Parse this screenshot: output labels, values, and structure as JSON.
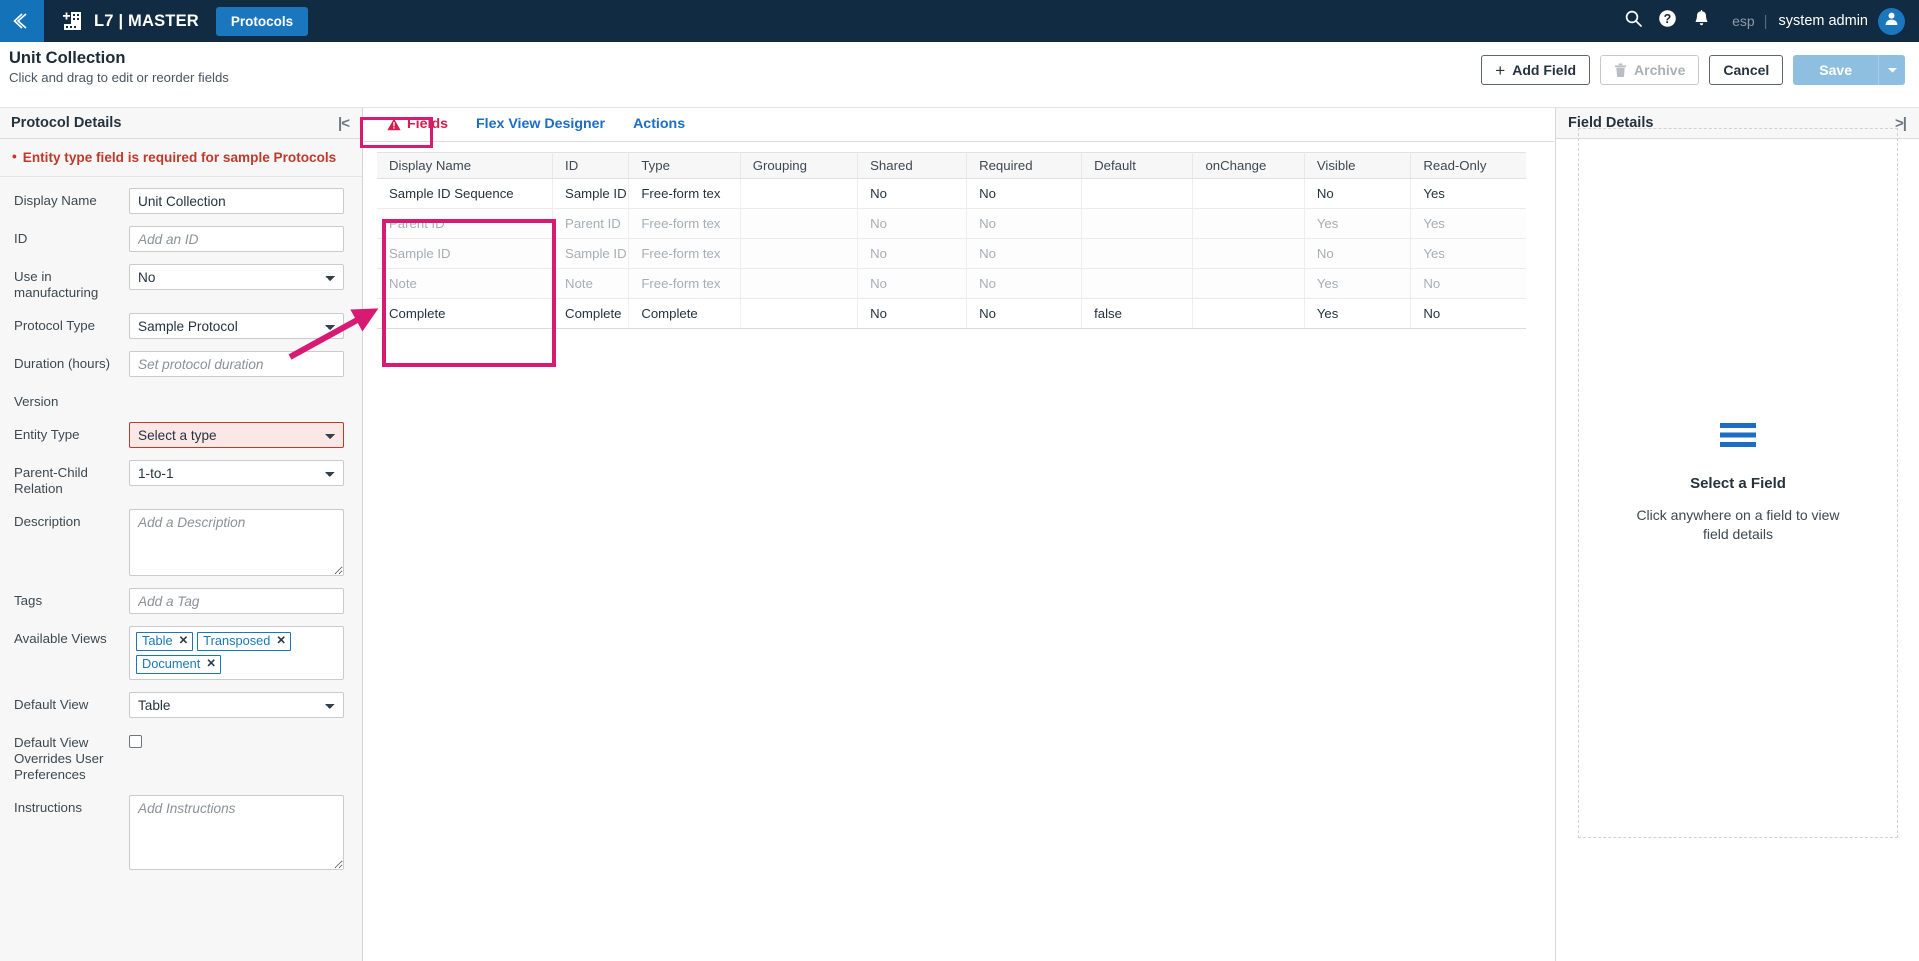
{
  "topnav": {
    "back_icon": "chevron-double-left-icon",
    "logo_icon": "building-plus-icon",
    "brand": "L7 | MASTER",
    "protocols_tab": "Protocols",
    "search_icon": "search-icon",
    "help_icon": "help-circle-icon",
    "notifications_icon": "bell-icon",
    "language": "esp",
    "separator": "|",
    "user": "system admin",
    "avatar_icon": "user-avatar-icon"
  },
  "pagehead": {
    "title": "Unit Collection",
    "subtitle": "Click and drag to edit or reorder fields",
    "add_field": "Add Field",
    "archive": "Archive",
    "cancel": "Cancel",
    "save": "Save",
    "save_caret_icon": "caret-down-icon",
    "archive_icon": "trash-icon",
    "add_icon": "plus-icon"
  },
  "left": {
    "title": "Protocol Details",
    "collapse_icon": "collapse-left-icon",
    "error": "Entity type field is required for sample Protocols",
    "error_bullet": "•",
    "fields": {
      "display_name_label": "Display Name",
      "display_name_value": "Unit Collection",
      "id_label": "ID",
      "id_placeholder": "Add an ID",
      "use_in_manufacturing_label": "Use in manufacturing",
      "use_in_manufacturing_value": "No",
      "protocol_type_label": "Protocol Type",
      "protocol_type_value": "Sample Protocol",
      "duration_label": "Duration (hours)",
      "duration_placeholder": "Set protocol duration",
      "version_label": "Version",
      "entity_type_label": "Entity Type",
      "entity_type_value": "Select a type",
      "parent_child_label": "Parent-Child Relation",
      "parent_child_value": "1-to-1",
      "description_label": "Description",
      "description_placeholder": "Add a Description",
      "tags_label": "Tags",
      "tags_placeholder": "Add a Tag",
      "available_views_label": "Available Views",
      "available_views": [
        "Table",
        "Transposed",
        "Document"
      ],
      "tag_remove_icon": "close-x-icon",
      "default_view_label": "Default View",
      "default_view_value": "Table",
      "default_view_overrides_label": "Default View Overrides User Preferences",
      "default_view_overrides_checked": false,
      "instructions_label": "Instructions",
      "instructions_placeholder": "Add Instructions"
    }
  },
  "center": {
    "tabs": [
      {
        "label": "Fields",
        "active": true,
        "icon": "warning-triangle-icon"
      },
      {
        "label": "Flex View Designer",
        "active": false
      },
      {
        "label": "Actions",
        "active": false
      }
    ],
    "table": {
      "columns": [
        "Display Name",
        "ID",
        "Type",
        "Grouping",
        "Shared",
        "Required",
        "Default",
        "onChange",
        "Visible",
        "Read-Only"
      ],
      "rows": [
        {
          "dim": false,
          "cells": [
            "Sample ID Sequence",
            "Sample ID",
            "Free-form tex",
            "",
            "No",
            "No",
            "",
            "",
            "No",
            "Yes"
          ]
        },
        {
          "dim": true,
          "cells": [
            "Parent ID",
            "Parent ID",
            "Free-form tex",
            "",
            "No",
            "No",
            "",
            "",
            "Yes",
            "Yes"
          ]
        },
        {
          "dim": true,
          "cells": [
            "Sample ID",
            "Sample ID",
            "Free-form tex",
            "",
            "No",
            "No",
            "",
            "",
            "No",
            "Yes"
          ]
        },
        {
          "dim": true,
          "cells": [
            "Note",
            "Note",
            "Free-form tex",
            "",
            "No",
            "No",
            "",
            "",
            "Yes",
            "No"
          ]
        },
        {
          "dim": false,
          "cells": [
            "Complete",
            "Complete",
            "Complete",
            "",
            "No",
            "No",
            "false",
            "",
            "Yes",
            "No"
          ]
        }
      ]
    }
  },
  "right": {
    "title": "Field Details",
    "collapse_icon": "collapse-right-icon",
    "placeholder_icon": "hamburger-lines-icon",
    "placeholder_title": "Select a Field",
    "placeholder_sub": "Click anywhere on a field to view field details"
  },
  "annotations": {
    "highlight_color": "#d81b72",
    "arrow_color": "#d81b72"
  }
}
